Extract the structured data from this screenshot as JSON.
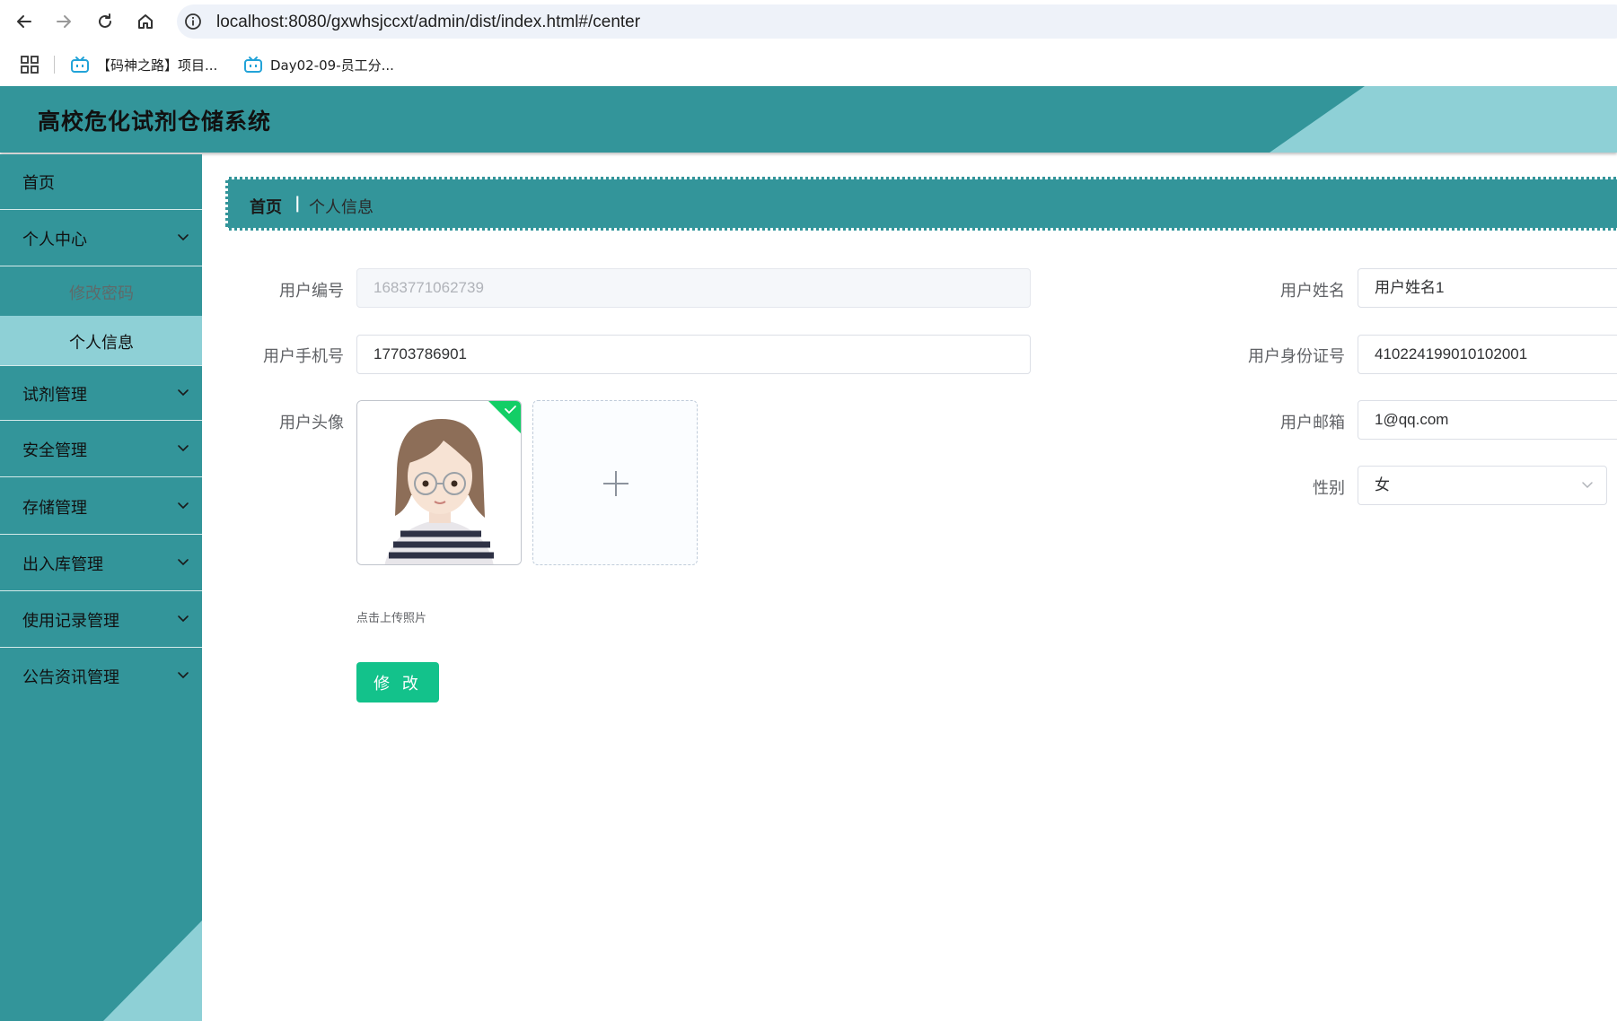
{
  "browser": {
    "url": "localhost:8080/gxwhsjccxt/admin/dist/index.html#/center",
    "bookmarks": [
      {
        "label": "【码神之路】项目..."
      },
      {
        "label": "Day02-09-员工分..."
      }
    ]
  },
  "header": {
    "title": "高校危化试剂仓储系统"
  },
  "sidebar": {
    "items": [
      {
        "label": "首页"
      },
      {
        "label": "个人中心"
      },
      {
        "label": "修改密码"
      },
      {
        "label": "个人信息"
      },
      {
        "label": "试剂管理"
      },
      {
        "label": "安全管理"
      },
      {
        "label": "存储管理"
      },
      {
        "label": "出入库管理"
      },
      {
        "label": "使用记录管理"
      },
      {
        "label": "公告资讯管理"
      }
    ]
  },
  "breadcrumb": {
    "home": "首页",
    "separator": "|",
    "current": "个人信息"
  },
  "form": {
    "user_id": {
      "label": "用户编号",
      "value": "1683771062739"
    },
    "user_name": {
      "label": "用户姓名",
      "value": "用户姓名1"
    },
    "phone": {
      "label": "用户手机号",
      "value": "17703786901"
    },
    "id_card": {
      "label": "用户身份证号",
      "value": "410224199010102001"
    },
    "avatar": {
      "label": "用户头像",
      "tip": "点击上传照片"
    },
    "email": {
      "label": "用户邮箱",
      "value": "1@qq.com"
    },
    "gender": {
      "label": "性别",
      "value": "女"
    },
    "submit_label": "修 改"
  },
  "colors": {
    "theme": "#33959a",
    "theme_light": "#8ed0d6",
    "button": "#13c28b"
  }
}
